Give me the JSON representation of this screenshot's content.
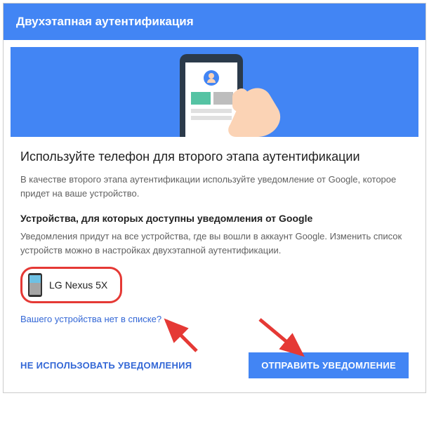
{
  "header": {
    "title": "Двухэтапная аутентификация"
  },
  "main": {
    "title": "Используйте телефон для второго этапа аутентификации",
    "description": "В качестве второго этапа аутентификации используйте уведомление от Google, которое придет на ваше устройство.",
    "devices_heading": "Устройства, для которых доступны уведомления от Google",
    "devices_description": "Уведомления придут на все устройства, где вы вошли в аккаунт Google. Изменить список устройств можно в настройках двухэтапной аутентификации.",
    "device": {
      "name": "LG Nexus 5X"
    },
    "missing_link": "Вашего устройства нет в списке?"
  },
  "actions": {
    "dont_use": "НЕ ИСПОЛЬЗОВАТЬ УВЕДОМЛЕНИЯ",
    "send": "ОТПРАВИТЬ УВЕДОМЛЕНИЕ"
  },
  "colors": {
    "primary": "#4285f4",
    "highlight": "#e53935"
  }
}
